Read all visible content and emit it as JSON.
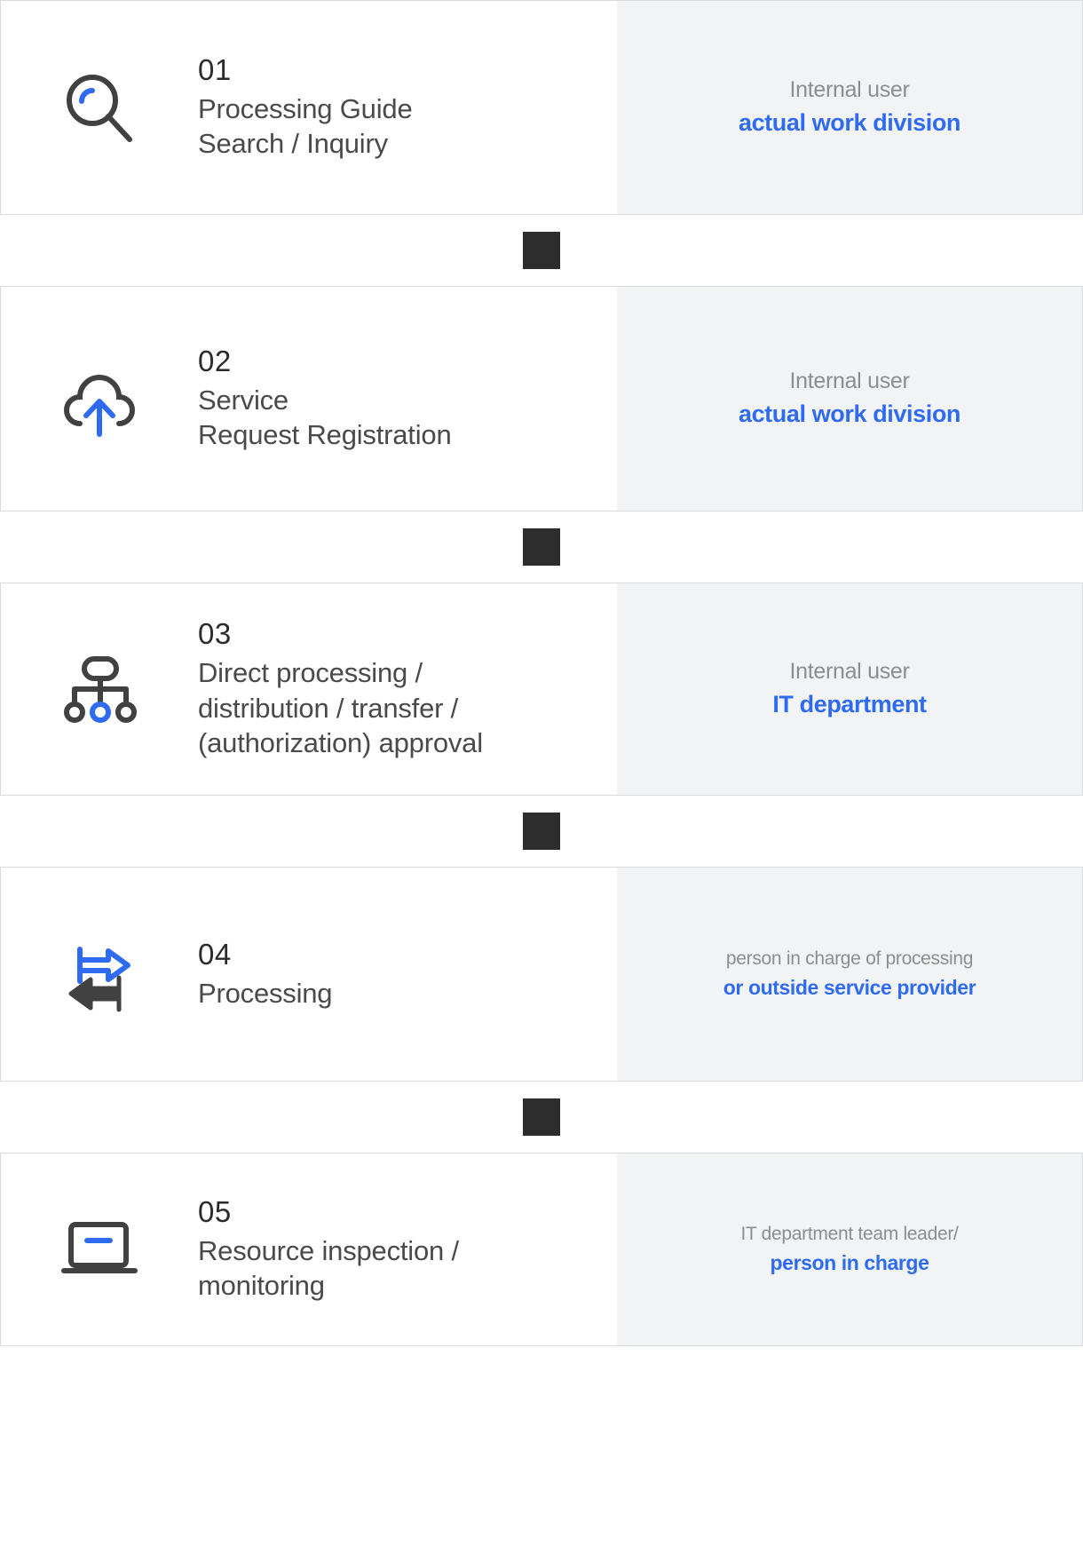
{
  "colors": {
    "accent": "#2f6bf0",
    "dark": "#2d2d2d",
    "icon_dark": "#414141",
    "muted_text": "#8a8d91",
    "panel_bg": "#f2f3f5",
    "border": "#d8dadd"
  },
  "connector": {
    "shape": "square"
  },
  "steps": [
    {
      "number": "01",
      "title": "Processing Guide\nSearch / Inquiry",
      "icon": "magnifier-icon",
      "role_top": "Internal user",
      "role_bottom": "actual work division",
      "role_size": "normal"
    },
    {
      "number": "02",
      "title": "Service\nRequest Registration",
      "icon": "cloud-upload-icon",
      "role_top": "Internal user",
      "role_bottom": "actual work division",
      "role_size": "normal"
    },
    {
      "number": "03",
      "title": "Direct processing /\ndistribution / transfer /\n(authorization) approval",
      "icon": "org-chart-icon",
      "role_top": "Internal user",
      "role_bottom": "IT department",
      "role_size": "normal"
    },
    {
      "number": "04",
      "title": "Processing",
      "icon": "exchange-arrows-icon",
      "role_top": "person in charge of processing",
      "role_bottom": "or outside service provider",
      "role_size": "small"
    },
    {
      "number": "05",
      "title": "Resource inspection /\nmonitoring",
      "icon": "laptop-icon",
      "role_top": "IT department team leader/",
      "role_bottom": "person in charge",
      "role_size": "small"
    }
  ]
}
